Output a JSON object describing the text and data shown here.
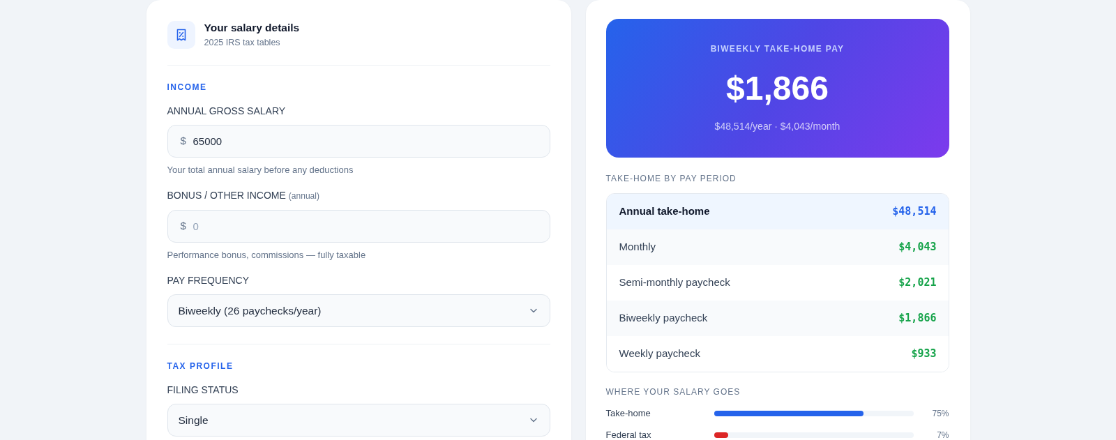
{
  "form": {
    "title": "Your salary details",
    "subtitle": "2025 IRS tax tables",
    "sections": [
      {
        "heading": "INCOME",
        "fields": [
          {
            "kind": "money",
            "label": "ANNUAL GROSS SALARY",
            "prefix": "$",
            "value": "65000",
            "hint": "Your total annual salary before any deductions"
          },
          {
            "kind": "money",
            "label": "BONUS / OTHER INCOME",
            "label_note": "(annual)",
            "prefix": "$",
            "placeholder": "0",
            "hint": "Performance bonus, commissions — fully taxable"
          },
          {
            "kind": "select",
            "label": "PAY FREQUENCY",
            "value": "Biweekly (26 paychecks/year)"
          }
        ]
      },
      {
        "heading": "TAX PROFILE",
        "fields": [
          {
            "kind": "select",
            "label": "FILING STATUS",
            "value": "Single"
          }
        ]
      }
    ]
  },
  "summary": {
    "caption": "BIWEEKLY TAKE-HOME PAY",
    "amount": "$1,866",
    "detail": "$48,514/year · $4,043/month"
  },
  "pay_periods": {
    "heading": "TAKE-HOME BY PAY PERIOD",
    "rows": [
      {
        "label": "Annual take-home",
        "value": "$48,514",
        "highlighted": true
      },
      {
        "label": "Monthly",
        "value": "$4,043",
        "highlighted": false
      },
      {
        "label": "Semi-monthly paycheck",
        "value": "$2,021",
        "highlighted": false
      },
      {
        "label": "Biweekly paycheck",
        "value": "$1,866",
        "highlighted": false
      },
      {
        "label": "Weekly paycheck",
        "value": "$933",
        "highlighted": false
      }
    ]
  },
  "breakdown": {
    "heading": "WHERE YOUR SALARY GOES",
    "items": [
      {
        "label": "Take-home",
        "level": 0.75,
        "reading": "75%",
        "color": "#2563eb"
      },
      {
        "label": "Federal tax",
        "level": 0.07,
        "reading": "7%",
        "color": "#dc2626"
      }
    ]
  }
}
